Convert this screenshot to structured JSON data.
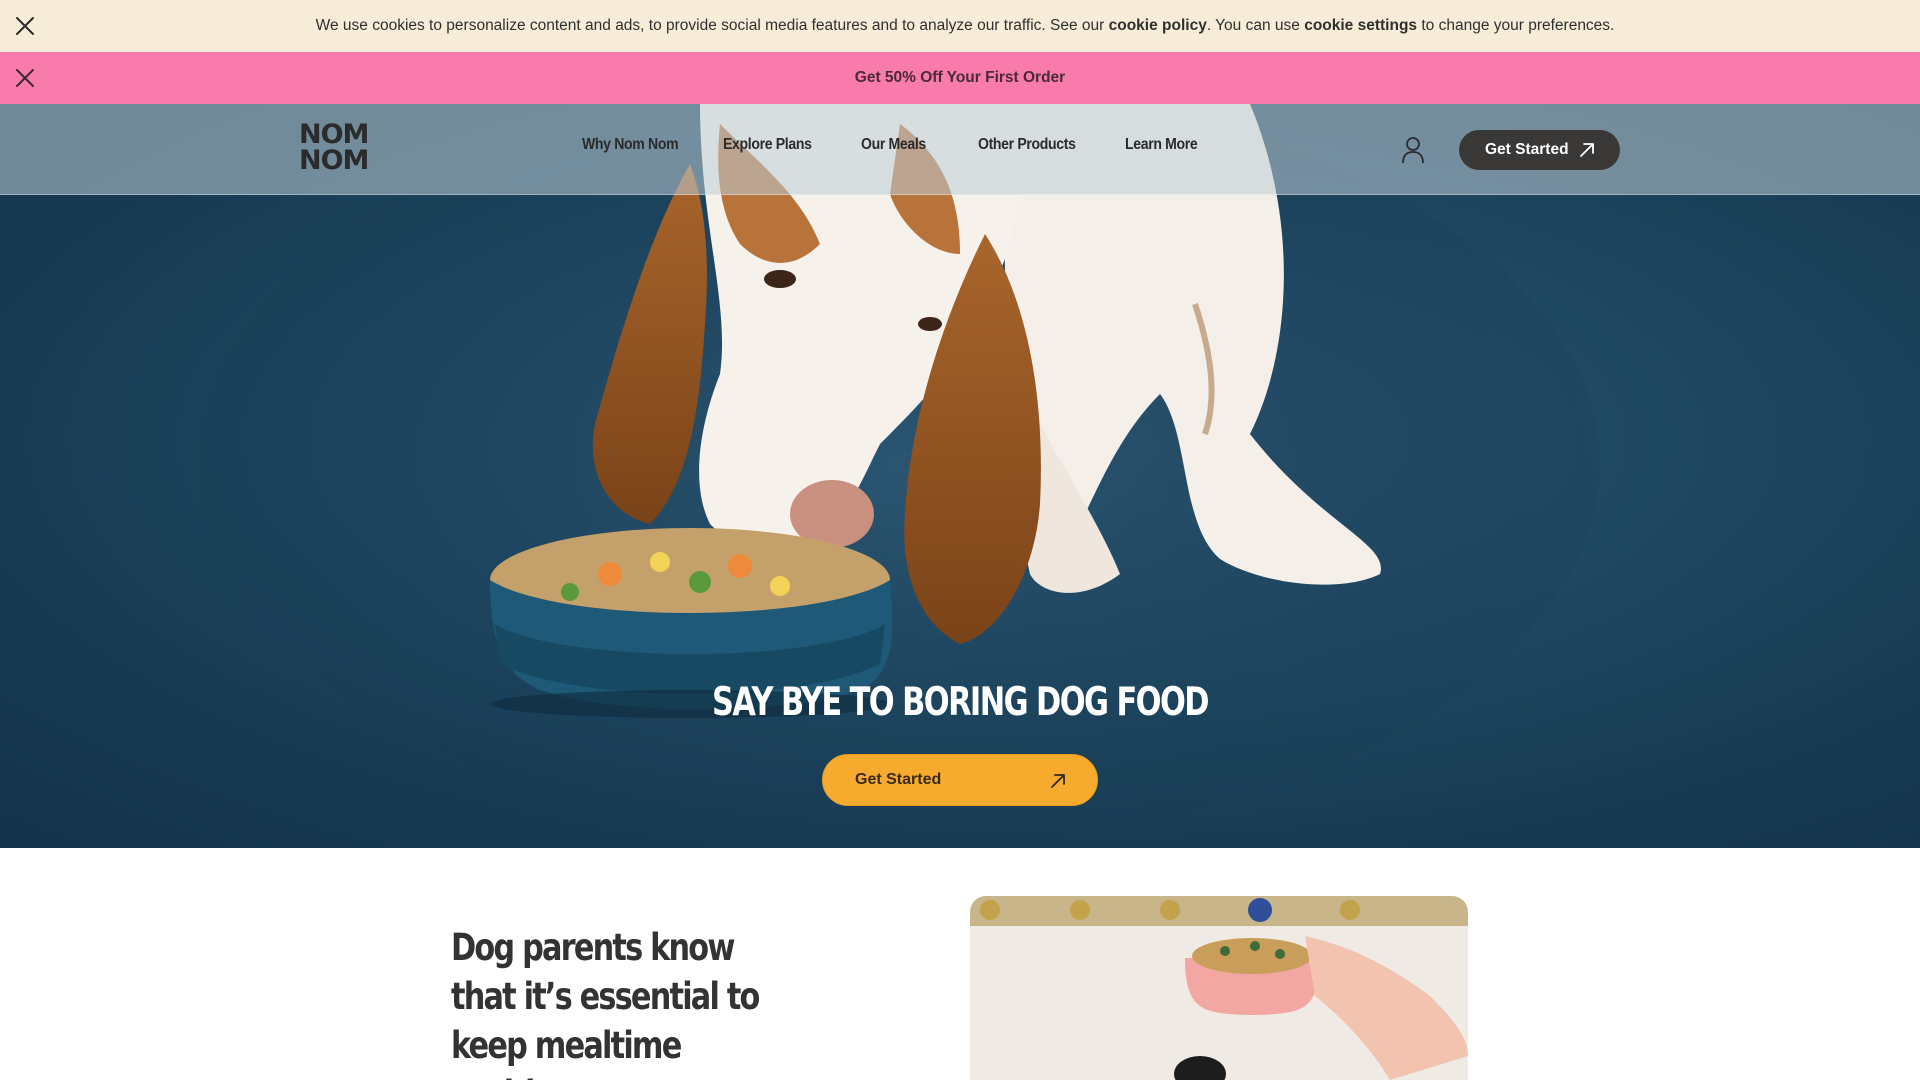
{
  "cookie_bar": {
    "text_before": "We use cookies to personalize content and ads, to provide social media features and to analyze our traffic. See our ",
    "policy_link": "cookie policy",
    "text_middle": ". You can use ",
    "settings_link": "cookie settings",
    "text_after": " to change your preferences.",
    "close_icon": "close-icon"
  },
  "promo_bar": {
    "text": "Get 50% Off Your First Order",
    "close_icon": "close-icon"
  },
  "header": {
    "logo_line1": "NOM",
    "logo_line2": "NOM",
    "nav": [
      {
        "label": "Why Nom Nom"
      },
      {
        "label": "Explore Plans"
      },
      {
        "label": "Our Meals"
      },
      {
        "label": "Other Products"
      },
      {
        "label": "Learn More"
      }
    ],
    "account_icon": "user-icon",
    "cta_label": "Get Started",
    "cta_icon": "arrow-up-right-icon"
  },
  "hero": {
    "title": "SAY BYE TO BORING DOG FOOD",
    "cta_label": "Get Started",
    "cta_icon": "arrow-up-right-icon"
  },
  "section": {
    "heading": "Dog parents know that it’s essential to keep mealtime exciting"
  },
  "colors": {
    "cookie_bg": "#f7ecd8",
    "promo_bg": "#f97bab",
    "hero_bg": "#1f4862",
    "cta_yellow": "#f6ab2f",
    "cta_dark": "#3a3836"
  }
}
